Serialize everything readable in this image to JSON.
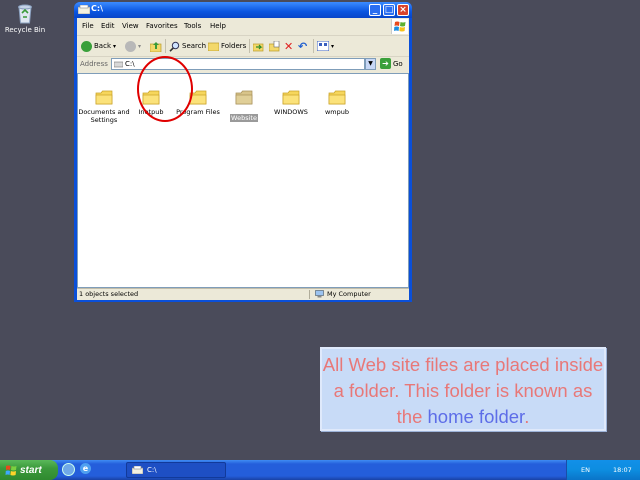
{
  "desktop": {
    "recycle_bin_label": "Recycle Bin"
  },
  "window": {
    "title": "C:\\",
    "menus": [
      "File",
      "Edit",
      "View",
      "Favorites",
      "Tools",
      "Help"
    ],
    "toolbar": {
      "back_label": "Back",
      "search_label": "Search",
      "folders_label": "Folders"
    },
    "address": {
      "label": "Address",
      "value": "C:\\",
      "go_label": "Go"
    },
    "folders": [
      {
        "name": "Documents and Settings"
      },
      {
        "name": "Inetpub"
      },
      {
        "name": "Program Files"
      },
      {
        "name": "Website"
      },
      {
        "name": "WINDOWS"
      },
      {
        "name": "wmpub"
      }
    ],
    "selected_folder": "Website",
    "status": {
      "left": "1 objects selected",
      "right": "My Computer"
    }
  },
  "caption": {
    "part1": "All Web site files are placed inside a folder. This folder is known as the ",
    "highlight": "home folder",
    "part2": "."
  },
  "taskbar": {
    "start_label": "start",
    "task_label": "C:\\",
    "language": "EN",
    "clock": "18:07"
  },
  "colors": {
    "desktop": "#4a4b5a",
    "caption_text": "#e87878",
    "caption_highlight": "#5d6de8",
    "annotation_circle": "#e00000"
  }
}
